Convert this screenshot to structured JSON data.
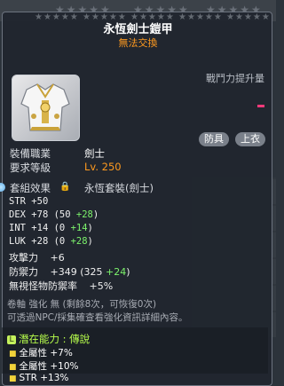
{
  "item": {
    "name": "永恆劍士鎧甲",
    "trade_status": "無法交換",
    "combat_power_label": "戰鬥力提升量",
    "tags": [
      "防具",
      "上衣"
    ]
  },
  "requirements": [
    {
      "label": "裝備職業",
      "value": "劍士"
    },
    {
      "label": "要求等級",
      "value": "Lv. 250"
    }
  ],
  "set_effect": {
    "label": "套組效果",
    "value": "永恆套裝(劍士)"
  },
  "stats": [
    {
      "name": "STR",
      "base": "+50",
      "detail": "",
      "bonus": ""
    },
    {
      "name": "DEX",
      "base": "+78",
      "detail": "(50",
      "bonus": "+28",
      "close": ")"
    },
    {
      "name": "INT",
      "base": "+14",
      "detail": "(0",
      "bonus": "+14",
      "close": ")"
    },
    {
      "name": "LUK",
      "base": "+28",
      "detail": "(0",
      "bonus": "+28",
      "close": ")"
    }
  ],
  "stats2": [
    {
      "name": "攻擊力",
      "base": "+6"
    },
    {
      "name": "防禦力",
      "base": "+349",
      "detail": "(325",
      "bonus": "+24",
      "close": ")"
    },
    {
      "name": "無視怪物防禦率",
      "base": "+5%"
    }
  ],
  "scroll_info": [
    "卷軸 強化 無 (剩餘8次，可恢復0次)",
    "可透過NPC/採集確查看強化資訊詳細內容。"
  ],
  "potential": {
    "header": "潛在能力 : 傳說",
    "icon_text": "L",
    "lines": [
      "全屬性 +7%",
      "全屬性 +10%",
      "STR +13%"
    ]
  },
  "colors": {
    "accent_orange": "#ff9a1f",
    "bonus_green": "#7cf26b",
    "potential_green": "#b8ff4c"
  }
}
